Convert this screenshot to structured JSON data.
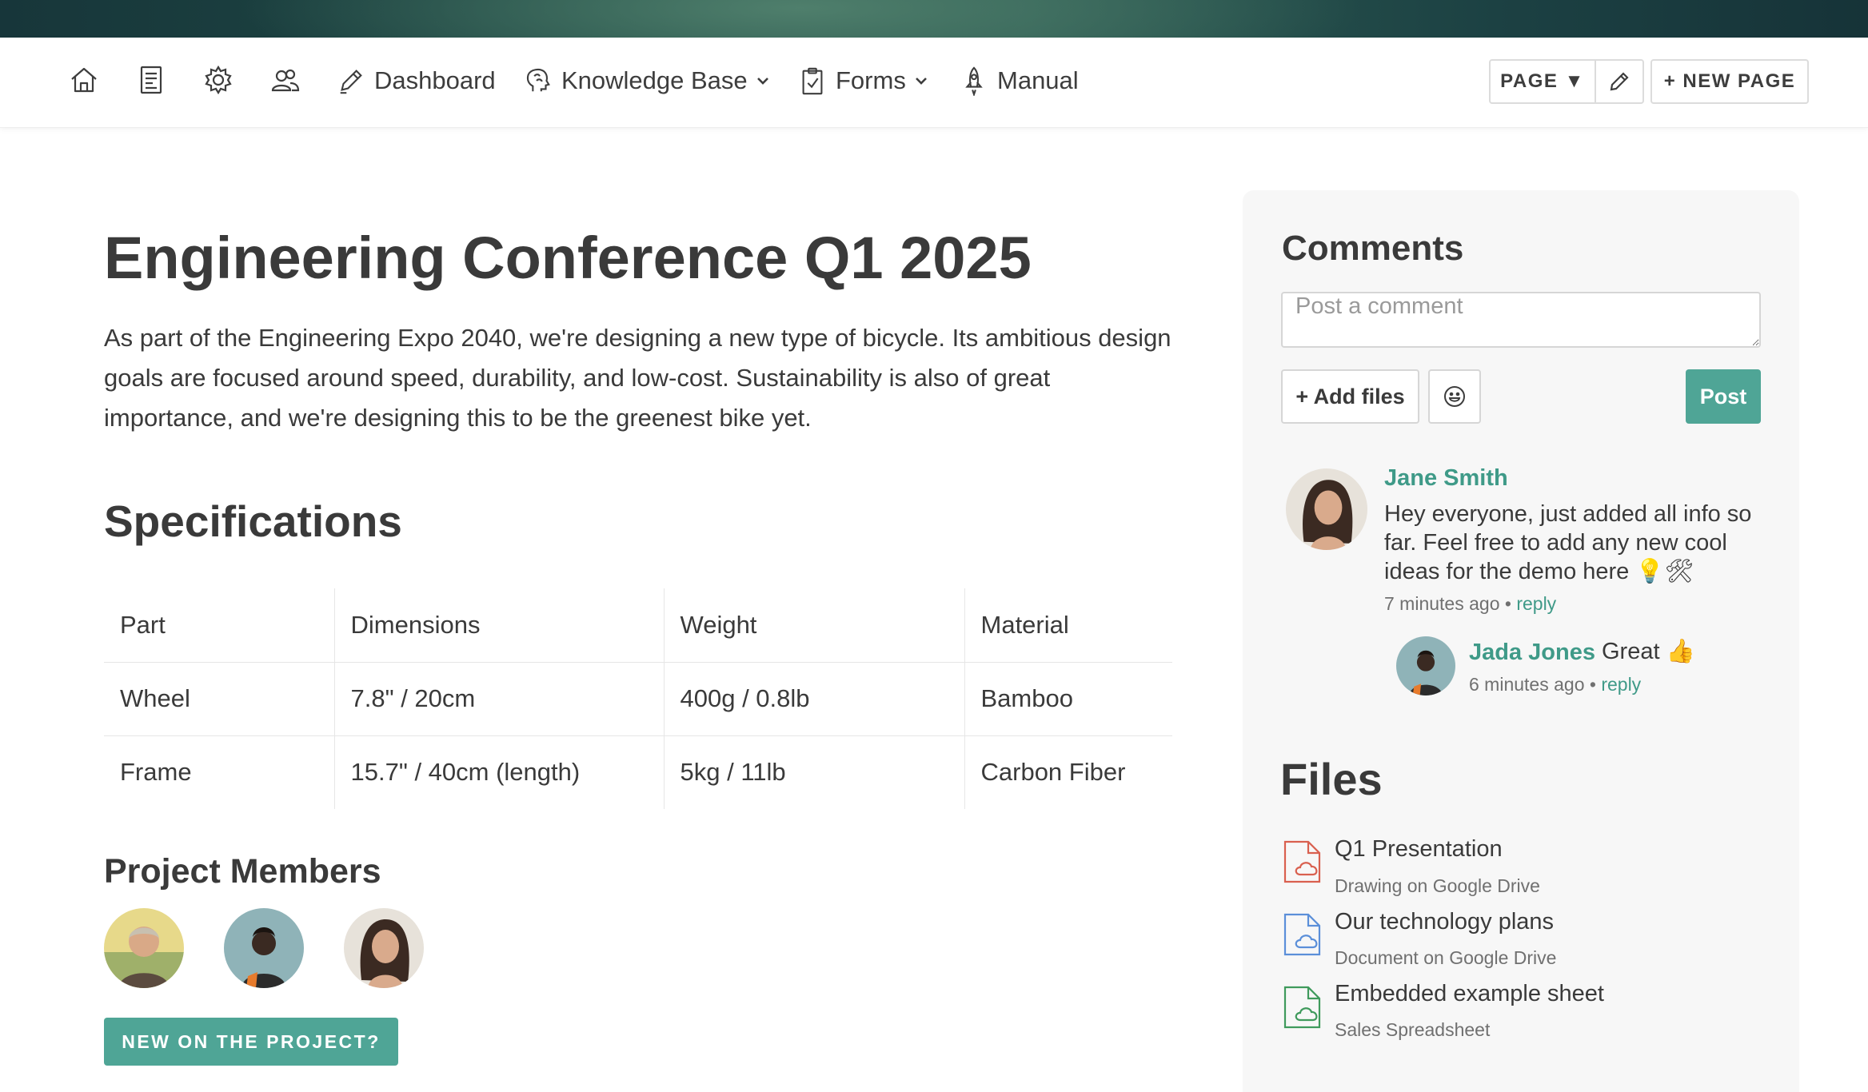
{
  "nav": {
    "icons": [
      "home-icon",
      "document-icon",
      "gear-icon",
      "users-icon"
    ],
    "dashboard": "Dashboard",
    "knowledge_base": "Knowledge Base",
    "forms": "Forms",
    "manual": "Manual"
  },
  "toolbar": {
    "page_menu": "PAGE ▼",
    "new_page": "+ NEW PAGE"
  },
  "main": {
    "title": "Engineering Conference Q1 2025",
    "intro": "As part of the Engineering Expo 2040, we're designing a new type of bicycle. Its ambitious design goals are focused around speed, durability, and low-cost. Sustainability is also of great importance, and we're designing this to be the greenest bike yet.",
    "specs_heading": "Specifications",
    "specs": {
      "headers": [
        "Part",
        "Dimensions",
        "Weight",
        "Material"
      ],
      "rows": [
        [
          "Wheel",
          "7.8\" / 20cm",
          "400g / 0.8lb",
          "Bamboo"
        ],
        [
          "Frame",
          "15.7\" / 40cm (length)",
          "5kg / 11lb",
          "Carbon Fiber"
        ]
      ]
    },
    "members_heading": "Project Members",
    "new_on_project": "NEW ON THE PROJECT?"
  },
  "comments": {
    "heading": "Comments",
    "placeholder": "Post a comment",
    "add_files": "+ Add files",
    "post": "Post",
    "items": [
      {
        "author": "Jane Smith",
        "text": "Hey everyone, just added all info so far. Feel free to add any new cool ideas for the demo here 💡🛠",
        "time": "7 minutes ago",
        "reply": "reply"
      },
      {
        "author": "Jada Jones",
        "text": "Great 👍",
        "time": "6 minutes ago",
        "reply": "reply"
      }
    ]
  },
  "files": {
    "heading": "Files",
    "items": [
      {
        "name": "Q1 Presentation",
        "sub": "Drawing on Google Drive",
        "color": "#d9604f"
      },
      {
        "name": "Our technology plans",
        "sub": "Document on Google Drive",
        "color": "#5b8fd9"
      },
      {
        "name": "Embedded example sheet",
        "sub": "Sales Spreadsheet",
        "color": "#3f9a5c"
      }
    ]
  },
  "colors": {
    "accent": "#4fa596",
    "link": "#3f9a88",
    "panel_bg": "#f7f7f7"
  }
}
